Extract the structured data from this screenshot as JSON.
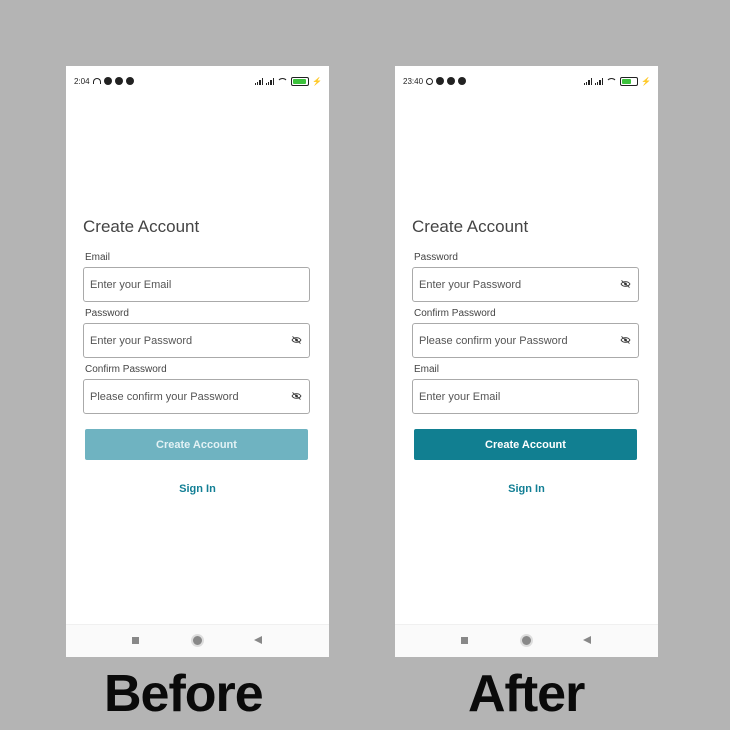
{
  "colors": {
    "accent": "#117f91",
    "accent_disabled": "#6fb3c1",
    "link": "#127f95",
    "background": "#b4b4b4"
  },
  "before": {
    "caption": "Before",
    "status_time": "2:04",
    "title": "Create Account",
    "fields": [
      {
        "label": "Email",
        "placeholder": "Enter your Email",
        "has_eye": false
      },
      {
        "label": "Password",
        "placeholder": "Enter your Password",
        "has_eye": true
      },
      {
        "label": "Confirm Password",
        "placeholder": "Please confirm your Password",
        "has_eye": true
      }
    ],
    "button_label": "Create Account",
    "button_state": "disabled",
    "signin_label": "Sign In"
  },
  "after": {
    "caption": "After",
    "status_time": "23:40",
    "title": "Create Account",
    "fields": [
      {
        "label": "Password",
        "placeholder": "Enter your Password",
        "has_eye": true
      },
      {
        "label": "Confirm Password",
        "placeholder": "Please confirm your Password",
        "has_eye": true
      },
      {
        "label": "Email",
        "placeholder": "Enter your Email",
        "has_eye": false
      }
    ],
    "button_label": "Create Account",
    "button_state": "enabled",
    "signin_label": "Sign In"
  },
  "icons": {
    "eye": "eye-off-icon",
    "nav_square": "recents-icon",
    "nav_circle": "home-icon",
    "nav_back": "back-icon"
  }
}
